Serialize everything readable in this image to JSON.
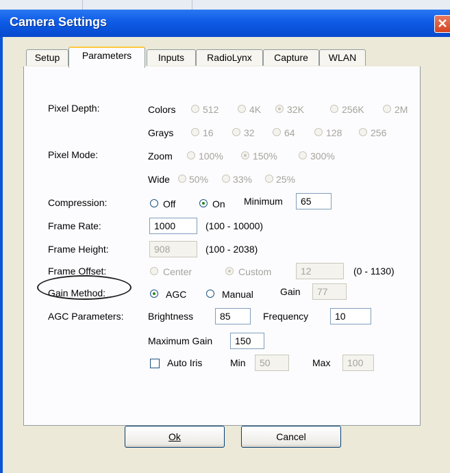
{
  "window": {
    "title": "Camera Settings"
  },
  "tabs": [
    {
      "label": "Setup"
    },
    {
      "label": "Parameters",
      "active": true
    },
    {
      "label": "Inputs"
    },
    {
      "label": "RadioLynx"
    },
    {
      "label": "Capture"
    },
    {
      "label": "WLAN"
    }
  ],
  "pixel_depth": {
    "label": "Pixel Depth:",
    "colors_label": "Colors",
    "colors_options": [
      "512",
      "4K",
      "32K",
      "256K",
      "2M"
    ],
    "colors_selected": "32K",
    "grays_label": "Grays",
    "grays_options": [
      "16",
      "32",
      "64",
      "128",
      "256"
    ]
  },
  "pixel_mode": {
    "label": "Pixel Mode:",
    "zoom_label": "Zoom",
    "zoom_options": [
      "100%",
      "150%",
      "300%"
    ],
    "zoom_selected": "150%",
    "wide_label": "Wide",
    "wide_options": [
      "50%",
      "33%",
      "25%"
    ]
  },
  "compression": {
    "label": "Compression:",
    "off_label": "Off",
    "on_label": "On",
    "selected": "On",
    "minimum_label": "Minimum",
    "minimum_value": "65"
  },
  "frame_rate": {
    "label": "Frame Rate:",
    "value": "1000",
    "range": "(100 - 10000)"
  },
  "frame_height": {
    "label": "Frame Height:",
    "value": "908",
    "range": "(100 - 2038)"
  },
  "frame_offset": {
    "label": "Frame Offset:",
    "center_label": "Center",
    "custom_label": "Custom",
    "selected": "Custom",
    "value": "12",
    "range": "(0 - 1130)"
  },
  "gain_method": {
    "label": "Gain Method:",
    "agc_label": "AGC",
    "manual_label": "Manual",
    "selected": "AGC",
    "gain_label": "Gain",
    "gain_value": "77"
  },
  "agc": {
    "label": "AGC Parameters:",
    "brightness_label": "Brightness",
    "brightness_value": "85",
    "frequency_label": "Frequency",
    "frequency_value": "10",
    "max_gain_label": "Maximum Gain",
    "max_gain_value": "150",
    "auto_iris_label": "Auto Iris",
    "auto_iris_checked": false,
    "min_label": "Min",
    "min_value": "50",
    "max_label": "Max",
    "max_value": "100"
  },
  "buttons": {
    "ok_label": "Ok",
    "cancel_label": "Cancel"
  },
  "colors": {
    "title_bar": "#0e5be6",
    "dialog_face": "#ece9d8",
    "tab_highlight": "#ffc83c",
    "close": "#d4431f"
  }
}
